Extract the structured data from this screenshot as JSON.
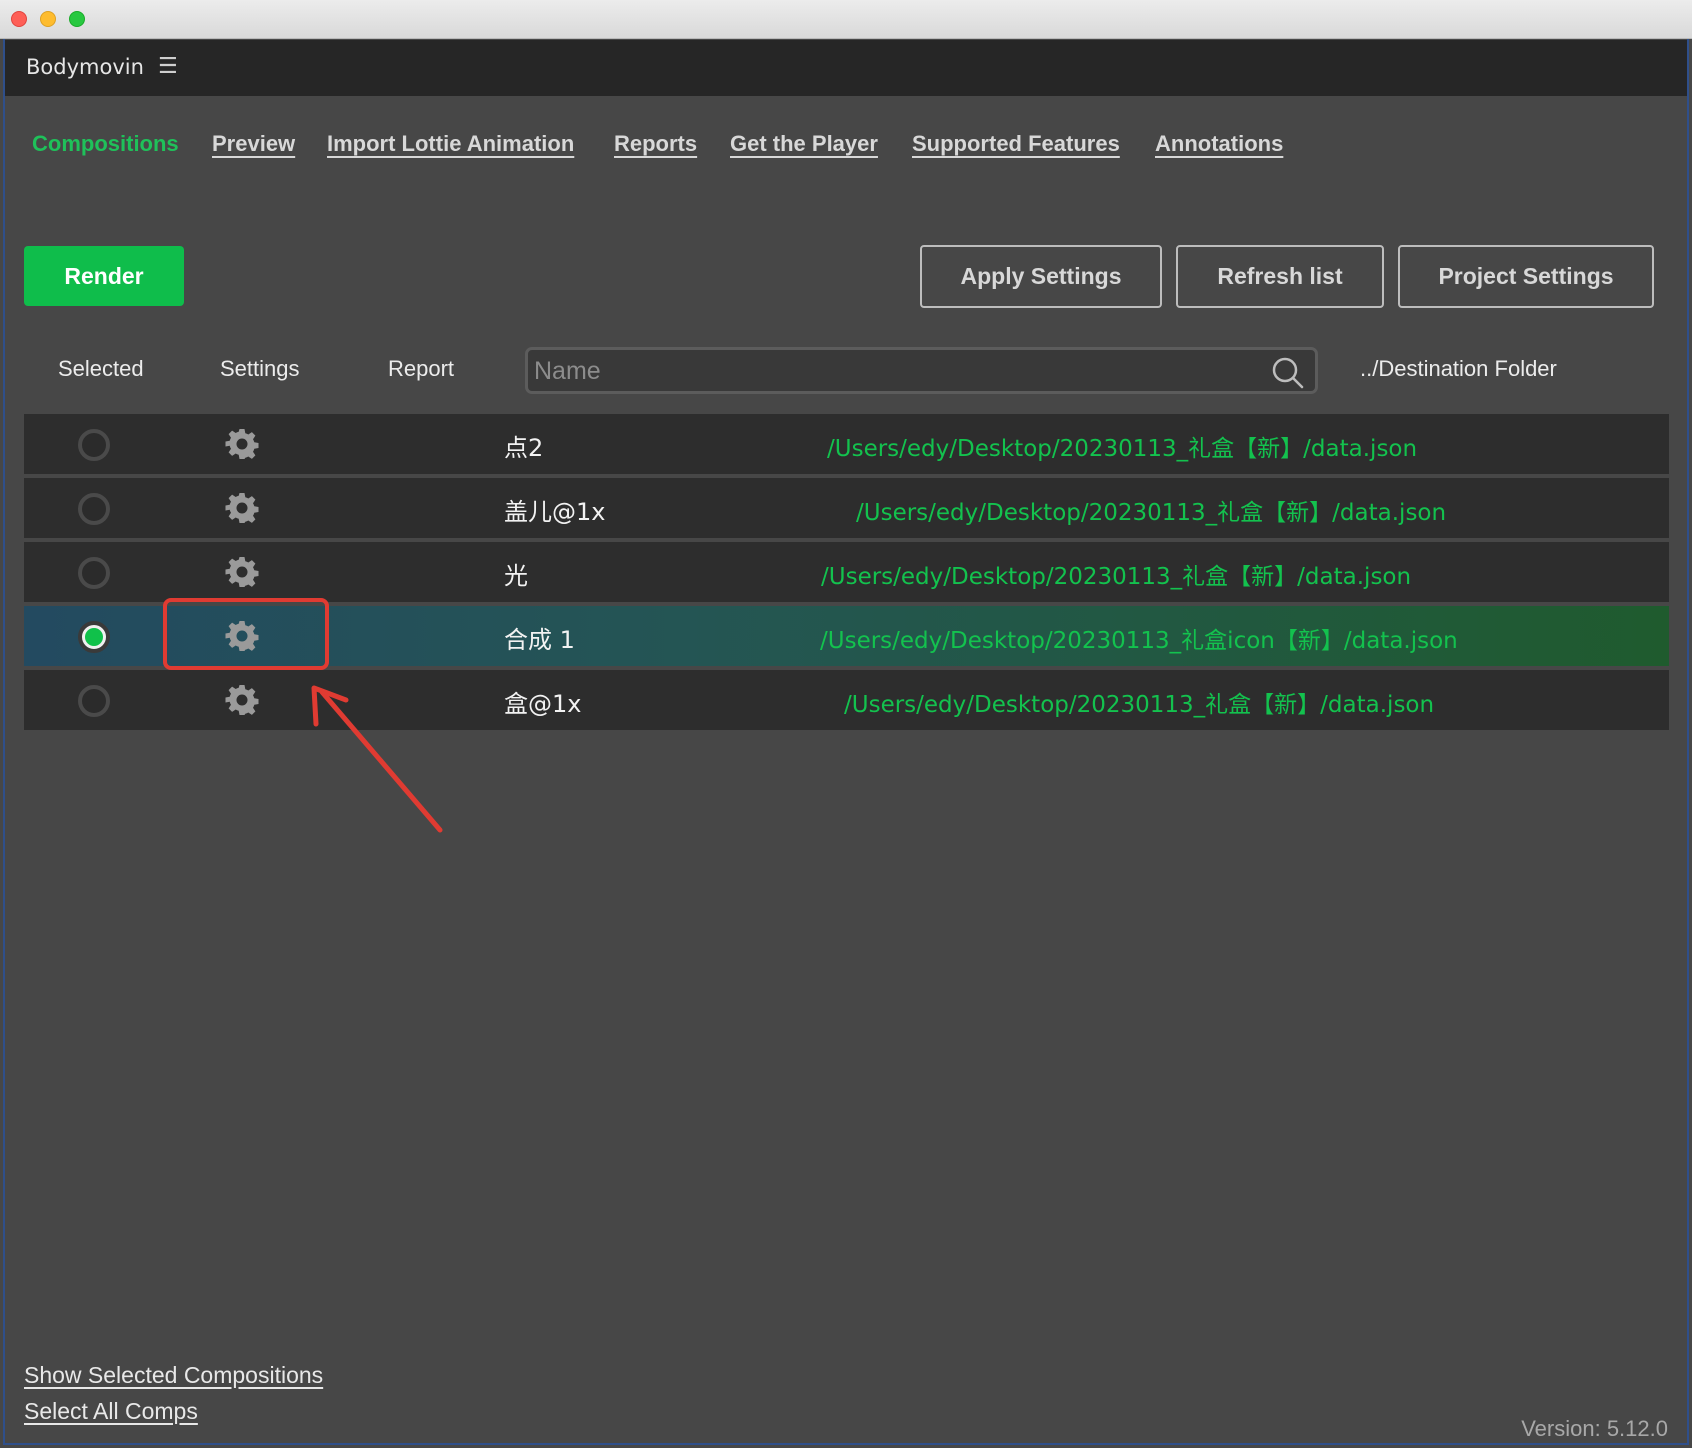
{
  "panel": {
    "title": "Bodymovin",
    "menu_icon": "hamburger-icon"
  },
  "nav": {
    "tabs": [
      {
        "label": "Compositions",
        "active": true
      },
      {
        "label": "Preview",
        "active": false
      },
      {
        "label": "Import Lottie Animation",
        "active": false
      },
      {
        "label": "Reports",
        "active": false
      },
      {
        "label": "Get the Player",
        "active": false
      },
      {
        "label": "Supported Features",
        "active": false
      },
      {
        "label": "Annotations",
        "active": false
      }
    ]
  },
  "toolbar": {
    "render_label": "Render",
    "apply_settings_label": "Apply Settings",
    "refresh_list_label": "Refresh list",
    "project_settings_label": "Project Settings"
  },
  "columns": {
    "selected": "Selected",
    "settings": "Settings",
    "report": "Report",
    "destination": "../Destination Folder"
  },
  "search": {
    "placeholder": "Name",
    "value": ""
  },
  "compositions": [
    {
      "name": "点2",
      "path": "/Users/edy/Desktop/20230113_礼盒【新】/data.json",
      "selected": false
    },
    {
      "name": "盖儿@1x",
      "path": "/Users/edy/Desktop/20230113_礼盒【新】/data.json",
      "selected": false
    },
    {
      "name": "光",
      "path": "/Users/edy/Desktop/20230113_礼盒【新】/data.json",
      "selected": false
    },
    {
      "name": "合成 1",
      "path": "/Users/edy/Desktop/20230113_礼盒icon【新】/data.json",
      "selected": true
    },
    {
      "name": "盒@1x",
      "path": "/Users/edy/Desktop/20230113_礼盒【新】/data.json",
      "selected": false
    }
  ],
  "footer": {
    "show_selected_label": "Show Selected Compositions",
    "select_all_label": "Select All Comps",
    "version": "Version: 5.12.0"
  },
  "colors": {
    "accent_green": "#13c24e",
    "annotation_red": "#e03b32",
    "background": "#474747"
  }
}
